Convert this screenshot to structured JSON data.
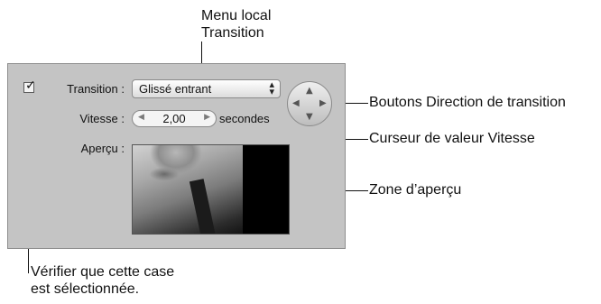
{
  "callouts": {
    "menu_local_line1": "Menu local",
    "menu_local_line2": "Transition",
    "boutons_direction": "Boutons Direction de transition",
    "curseur_vitesse": "Curseur de valeur Vitesse",
    "zone_apercu": "Zone d’aperçu",
    "verifier_line1": "Vérifier que cette case",
    "verifier_line2": "est sélectionnée."
  },
  "panel": {
    "checkbox_checked": true,
    "transition_label": "Transition :",
    "transition_value": "Glissé entrant",
    "vitesse_label": "Vitesse :",
    "vitesse_value": "2,00",
    "vitesse_unit": "secondes",
    "apercu_label": "Aperçu :"
  },
  "icons": {
    "checkbox": "checkmark",
    "select": "up-down-arrows",
    "stepper_left": "triangle-left",
    "stepper_right": "triangle-right",
    "direction": [
      "triangle-up",
      "triangle-left",
      "triangle-right",
      "triangle-down"
    ]
  },
  "colors": {
    "panel_bg": "#c4c4c4",
    "preview_bg": "#000000"
  }
}
